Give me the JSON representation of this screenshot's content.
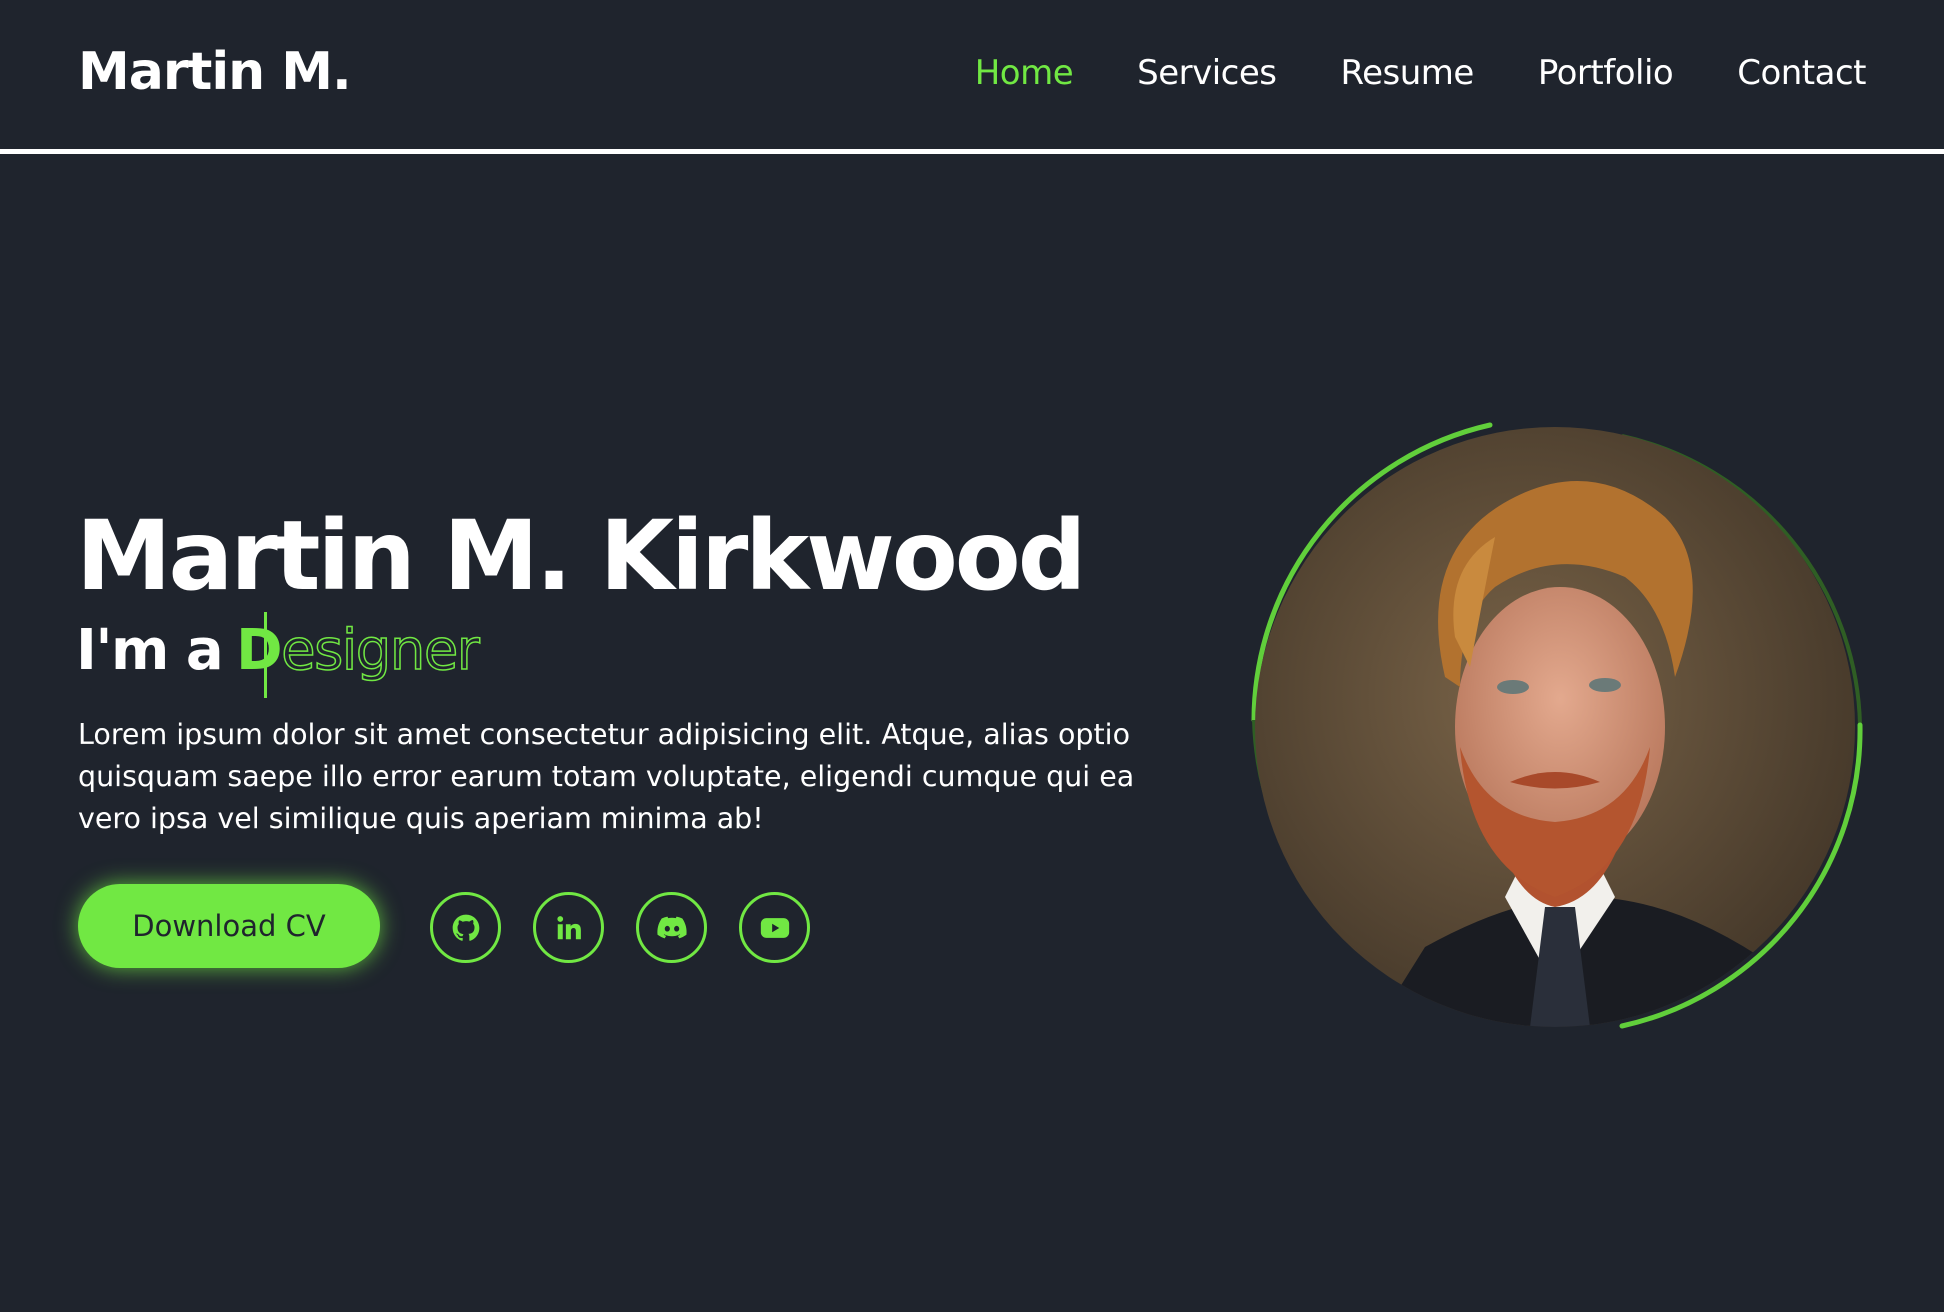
{
  "header": {
    "logo": "Martin M.",
    "nav": [
      {
        "label": "Home",
        "active": true
      },
      {
        "label": "Services",
        "active": false
      },
      {
        "label": "Resume",
        "active": false
      },
      {
        "label": "Portfolio",
        "active": false
      },
      {
        "label": "Contact",
        "active": false
      }
    ]
  },
  "hero": {
    "name": "Martin M. Kirkwood",
    "role_prefix": "I'm a",
    "role_filled": "D",
    "role_outline": "esigner",
    "description": "Lorem ipsum dolor sit amet consectetur adipisicing elit. Atque, alias optio quisquam saepe illo error earum totam voluptate, eligendi cumque qui ea vero ipsa vel similique quis aperiam minima ab!",
    "download_label": "Download CV",
    "socials": [
      {
        "icon": "github-icon"
      },
      {
        "icon": "linkedin-icon"
      },
      {
        "icon": "discord-icon"
      },
      {
        "icon": "youtube-icon"
      }
    ]
  },
  "colors": {
    "background": "#1f242d",
    "accent": "#71e843",
    "text": "#ffffff"
  }
}
